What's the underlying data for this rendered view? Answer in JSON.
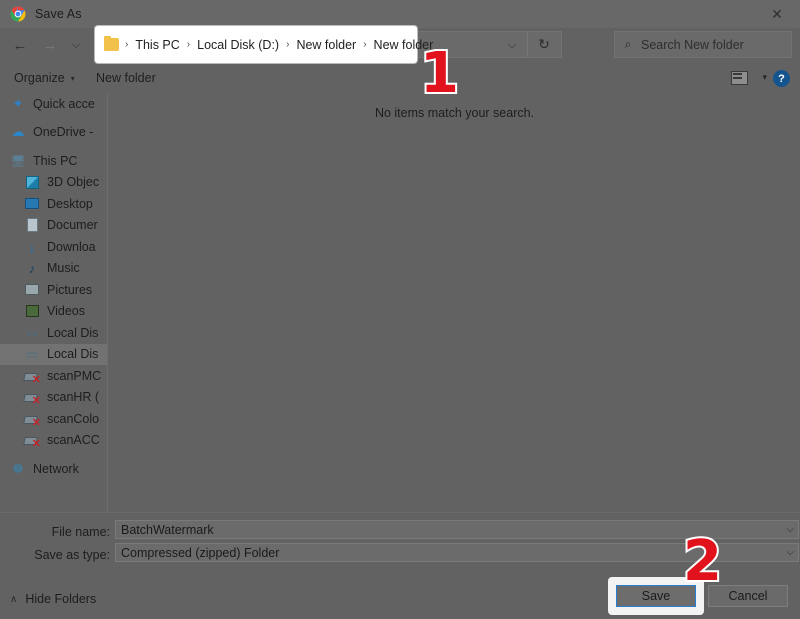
{
  "window": {
    "title": "Save As",
    "app_icon": "chrome-logo-icon",
    "close_label": "✕"
  },
  "nav": {
    "back": "←",
    "forward": "→",
    "recent": "⌵",
    "up": "↑",
    "address_chevron": "⌵",
    "refresh": "↻"
  },
  "breadcrumb": {
    "folder_icon": "folder-icon",
    "separator": "›",
    "items": [
      "This PC",
      "Local Disk (D:)",
      "New folder",
      "New folder"
    ]
  },
  "search": {
    "icon": "⌕",
    "placeholder": "Search New folder"
  },
  "commandbar": {
    "organize": "Organize",
    "organize_caret": "▾",
    "new_folder": "New folder",
    "view_caret": "▾",
    "help": "?"
  },
  "sidebar": {
    "items": [
      {
        "label": "Quick acce",
        "icon": "star-icon",
        "indent": 0,
        "selected": false,
        "gap_before": false
      },
      {
        "label": "OneDrive -",
        "icon": "cloud-icon",
        "indent": 0,
        "selected": false,
        "gap_before": true
      },
      {
        "label": "This PC",
        "icon": "computer-icon",
        "indent": 0,
        "selected": false,
        "gap_before": true
      },
      {
        "label": "3D Objec",
        "icon": "3d-objects-icon",
        "indent": 1,
        "selected": false,
        "gap_before": false
      },
      {
        "label": "Desktop",
        "icon": "desktop-icon",
        "indent": 1,
        "selected": false,
        "gap_before": false
      },
      {
        "label": "Documer",
        "icon": "documents-icon",
        "indent": 1,
        "selected": false,
        "gap_before": false
      },
      {
        "label": "Downloa",
        "icon": "downloads-icon",
        "indent": 1,
        "selected": false,
        "gap_before": false
      },
      {
        "label": "Music",
        "icon": "music-icon",
        "indent": 1,
        "selected": false,
        "gap_before": false
      },
      {
        "label": "Pictures",
        "icon": "pictures-icon",
        "indent": 1,
        "selected": false,
        "gap_before": false
      },
      {
        "label": "Videos",
        "icon": "videos-icon",
        "indent": 1,
        "selected": false,
        "gap_before": false
      },
      {
        "label": "Local Dis",
        "icon": "local-disk-icon",
        "indent": 1,
        "selected": false,
        "gap_before": false
      },
      {
        "label": "Local Dis",
        "icon": "local-disk-icon",
        "indent": 1,
        "selected": true,
        "gap_before": false
      },
      {
        "label": "scanPMC",
        "icon": "disconnected-network-drive-icon",
        "indent": 1,
        "selected": false,
        "gap_before": false
      },
      {
        "label": "scanHR (",
        "icon": "disconnected-network-drive-icon",
        "indent": 1,
        "selected": false,
        "gap_before": false
      },
      {
        "label": "scanColo",
        "icon": "disconnected-network-drive-icon",
        "indent": 1,
        "selected": false,
        "gap_before": false
      },
      {
        "label": "scanACC",
        "icon": "disconnected-network-drive-icon",
        "indent": 1,
        "selected": false,
        "gap_before": false
      },
      {
        "label": "Network",
        "icon": "network-icon",
        "indent": 0,
        "selected": false,
        "gap_before": true
      }
    ]
  },
  "filelist": {
    "empty_message": "No items match your search."
  },
  "form": {
    "filename_label": "File name:",
    "filename_value": "BatchWatermark",
    "savetype_label": "Save as type:",
    "savetype_value": "Compressed (zipped) Folder",
    "chevron": "⌵",
    "hide_folders": "Hide Folders",
    "hide_folders_caret": "∧",
    "save_label": "Save",
    "cancel_label": "Cancel"
  },
  "annotations": {
    "step1": "1",
    "step2": "2",
    "color": "#e1121b"
  }
}
